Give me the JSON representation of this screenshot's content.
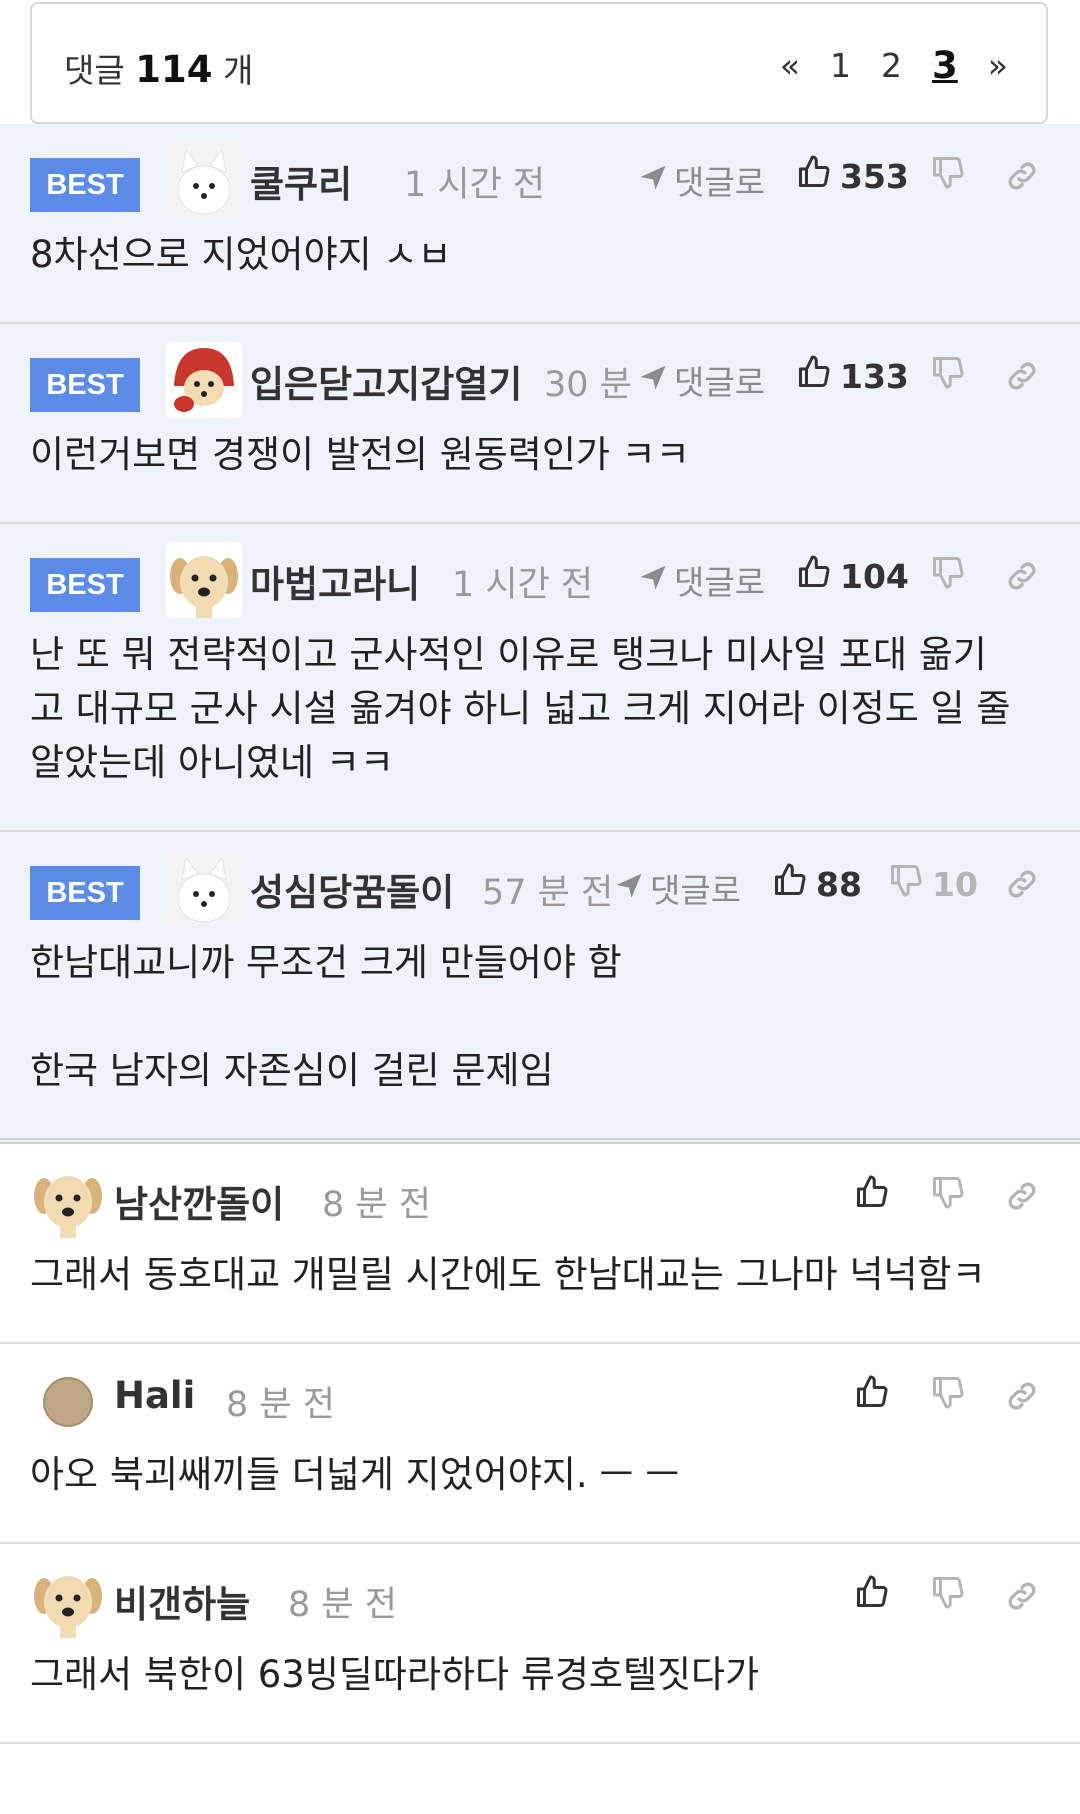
{
  "header": {
    "count_prefix": "댓글",
    "count": "114",
    "count_suffix": "개",
    "pager": {
      "prev": "«",
      "pages": [
        "1",
        "2",
        "3"
      ],
      "current": "3",
      "next": "»"
    }
  },
  "reply_label": "댓글로",
  "best_label": "BEST",
  "colors": {
    "best_badge": "#5d8be8",
    "best_bg": "#eef2fb"
  },
  "comments": [
    {
      "best": true,
      "avatar": "white-fox",
      "nick": "쿨쿠리",
      "time": "1 시간 전",
      "likes": "353",
      "dislikes": "",
      "text": "8차선으로 지었어야지 ㅅㅂ"
    },
    {
      "best": true,
      "avatar": "red-hood-dog",
      "nick": "입은닫고지갑열기",
      "time": "30 분",
      "likes": "133",
      "dislikes": "",
      "text": "이런거보면 경쟁이 발전의 원동력인가 ㅋㅋ"
    },
    {
      "best": true,
      "avatar": "puppy",
      "nick": "마법고라니",
      "time": "1 시간 전",
      "likes": "104",
      "dislikes": "",
      "text": "난 또 뭐 전략적이고 군사적인 이유로 탱크나 미사일 포대 옮기\n고 대규모 군사 시설 옮겨야 하니 넓고 크게 지어라 이정도 일 줄\n알았는데 아니였네 ㅋㅋ"
    },
    {
      "best": true,
      "avatar": "white-fox",
      "nick": "성심당꿈돌이",
      "time": "57 분 전",
      "likes": "88",
      "dislikes": "10",
      "text": "한남대교니까 무조건 크게 만들어야 함\n\n한국 남자의 자존심이 걸린 문제임"
    },
    {
      "best": false,
      "avatar": "puppy",
      "nick": "남산깐돌이",
      "time": "8 분 전",
      "likes": "",
      "dislikes": "",
      "text": "그래서 동호대교 개밀릴 시간에도 한남대교는 그나마 넉넉함ㅋ"
    },
    {
      "best": false,
      "avatar": "circle",
      "nick": "Hali",
      "time": "8 분 전",
      "likes": "",
      "dislikes": "",
      "text": "아오 북괴쌔끼들 더넓게 지었어야지. ㅡ ㅡ"
    },
    {
      "best": false,
      "avatar": "puppy",
      "nick": "비갠하늘",
      "time": "8 분 전",
      "likes": "",
      "dislikes": "",
      "text": "그래서 북한이 63빙딜따라하다 류경호텔짓다가"
    }
  ]
}
